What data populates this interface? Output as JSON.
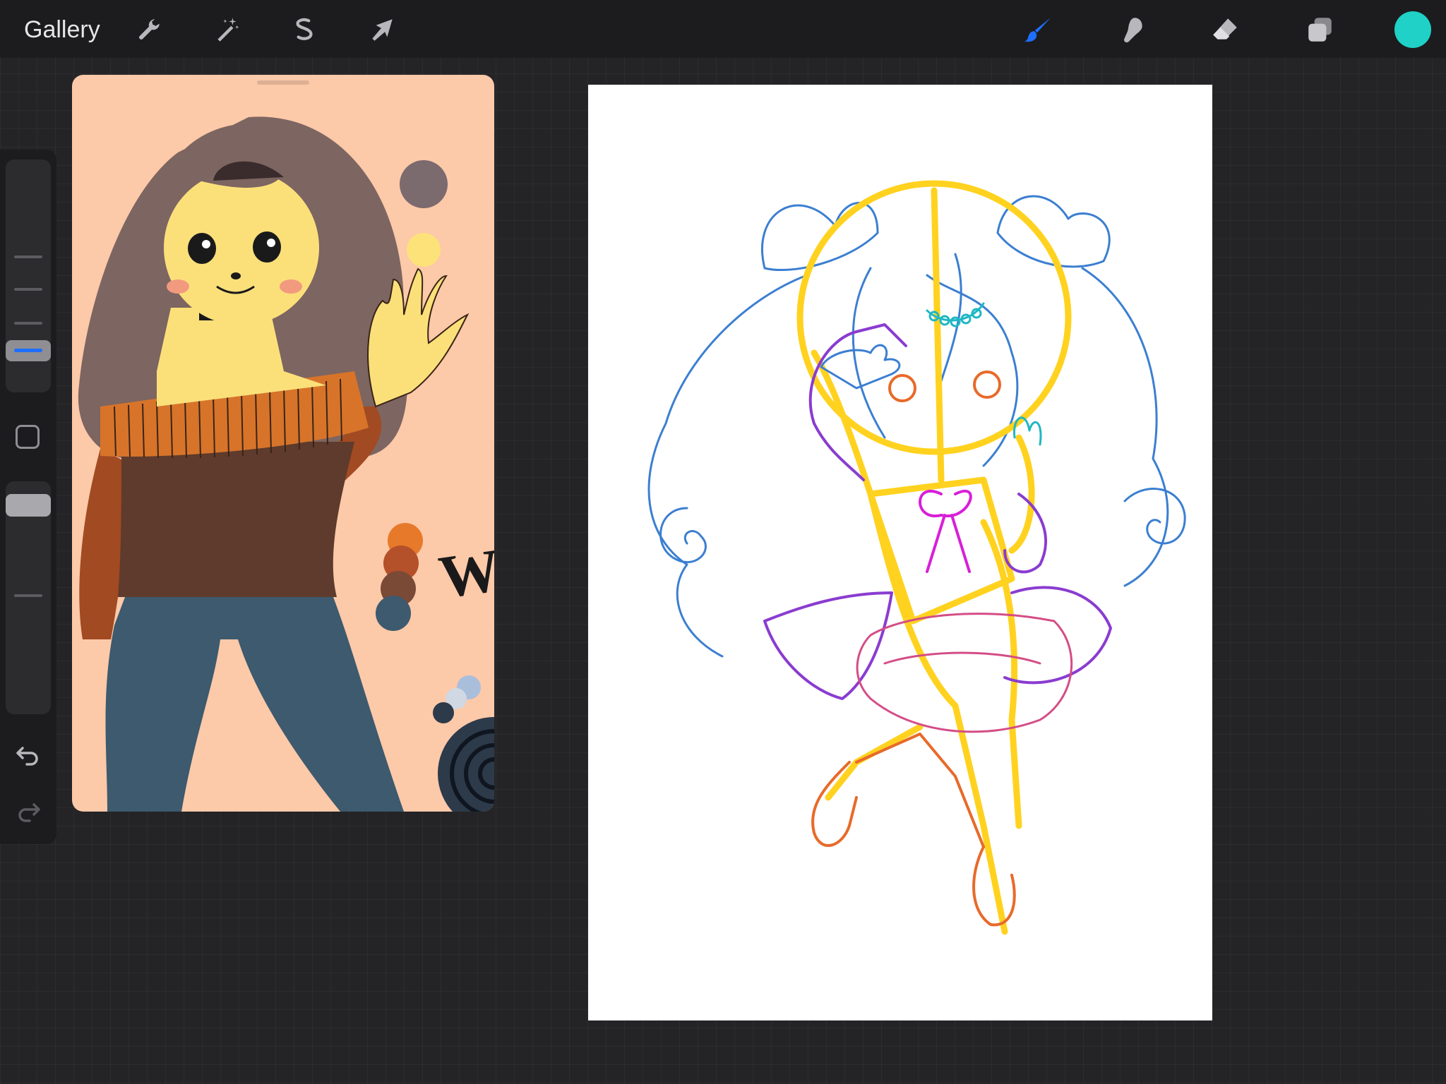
{
  "topbar": {
    "gallery_label": "Gallery",
    "left_tools": [
      {
        "icon": "wrench-icon",
        "name": "actions"
      },
      {
        "icon": "magic-wand-icon",
        "name": "adjustments"
      },
      {
        "icon": "selection-icon",
        "name": "selection"
      },
      {
        "icon": "arrow-cursor-icon",
        "name": "transform"
      }
    ],
    "right_tools": [
      {
        "icon": "brush-icon",
        "name": "brush",
        "active": true
      },
      {
        "icon": "smudge-icon",
        "name": "smudge",
        "active": false
      },
      {
        "icon": "eraser-icon",
        "name": "eraser",
        "active": false
      },
      {
        "icon": "layers-icon",
        "name": "layers",
        "active": false
      }
    ],
    "current_color": "#1fd1c6",
    "active_tool_color": "#1e6fff"
  },
  "sidebar": {
    "brush_size_icon": "brush-size-slider",
    "opacity_icon": "opacity-slider",
    "modifier_icon": "square-modifier-icon",
    "undo_icon": "undo-icon",
    "redo_icon": "redo-icon"
  },
  "reference_window": {
    "handwriting_text": "Wi",
    "palette": [
      "#7b6a6e",
      "#fde27a",
      "#e77a2a",
      "#b4502a",
      "#7a4a36",
      "#3d5a6e",
      "#a9bedb",
      "#d0d8e4",
      "#2d3a4a"
    ]
  },
  "canvas": {
    "background": "#ffffff",
    "sketch_colors": [
      "#ffd21f",
      "#3b7fd1",
      "#8a3cd0",
      "#d44d86",
      "#e86a2a",
      "#d81fd8"
    ]
  }
}
